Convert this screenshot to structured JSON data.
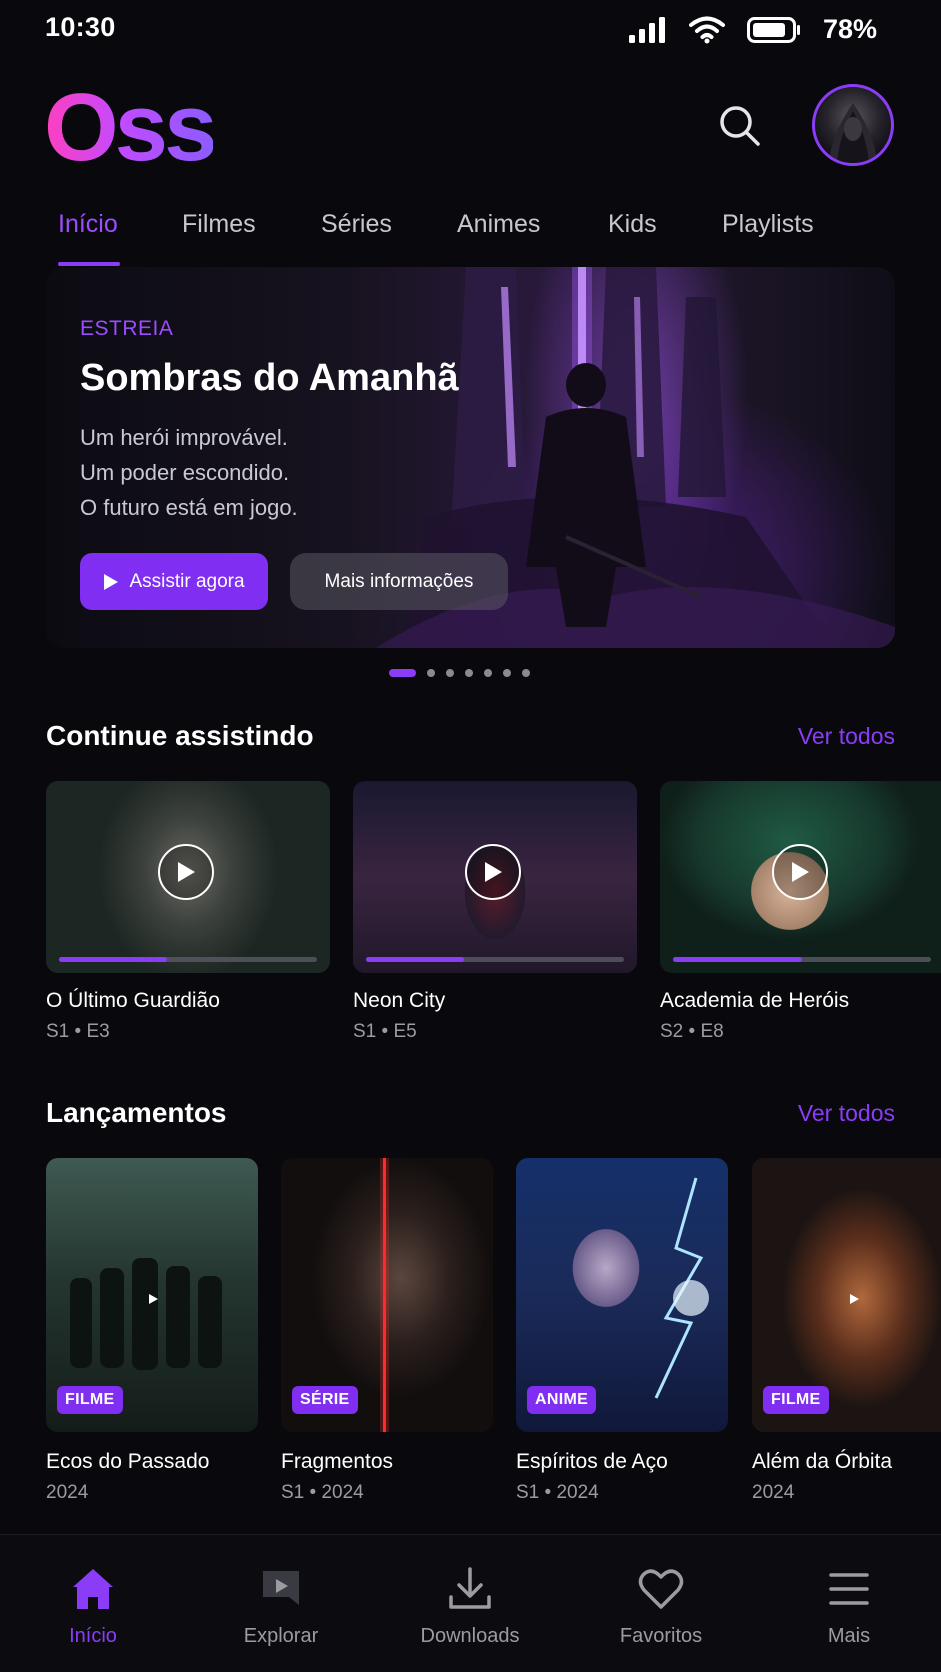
{
  "status": {
    "time": "10:30",
    "battery": "78%"
  },
  "brand": {
    "logo": "Oss",
    "accent": "#8b3cf7"
  },
  "header": {
    "search_icon": "search-icon",
    "avatar_icon": "avatar"
  },
  "tabs": [
    {
      "label": "Início",
      "active": true
    },
    {
      "label": "Filmes"
    },
    {
      "label": "Séries"
    },
    {
      "label": "Animes"
    },
    {
      "label": "Kids"
    },
    {
      "label": "Playlists"
    }
  ],
  "hero": {
    "kicker": "ESTREIA",
    "title": "Sombras do Amanhã",
    "taglines": [
      "Um herói improvável.",
      "Um poder escondido.",
      "O futuro está em jogo."
    ],
    "primary_label": "Assistir agora",
    "secondary_label": "Mais informações",
    "pager": {
      "count": 7,
      "active": 0
    }
  },
  "continue": {
    "title": "Continue assistindo",
    "link": "Ver todos",
    "items": [
      {
        "title": "O Último Guardião",
        "sub": "S1 • E3",
        "progress": 0.42
      },
      {
        "title": "Neon City",
        "sub": "S1 • E5",
        "progress": 0.38
      },
      {
        "title": "Academia de Heróis",
        "sub": "S2 • E8",
        "progress": 0.5
      }
    ]
  },
  "releases": {
    "title": "Lançamentos",
    "link": "Ver todos",
    "items": [
      {
        "badge": "FILME",
        "title": "Ecos do Passado",
        "sub": "2024"
      },
      {
        "badge": "SÉRIE",
        "title": "Fragmentos",
        "sub": "S1 • 2024"
      },
      {
        "badge": "ANIME",
        "title": "Espíritos de Aço",
        "sub": "S1 • 2024"
      },
      {
        "badge": "FILME",
        "title": "Além da Órbita",
        "sub": "2024"
      }
    ]
  },
  "nav": [
    {
      "label": "Início",
      "icon": "home-icon",
      "active": true
    },
    {
      "label": "Explorar",
      "icon": "explore-icon"
    },
    {
      "label": "Downloads",
      "icon": "download-icon"
    },
    {
      "label": "Favoritos",
      "icon": "heart-icon"
    },
    {
      "label": "Mais",
      "icon": "menu-icon"
    }
  ]
}
